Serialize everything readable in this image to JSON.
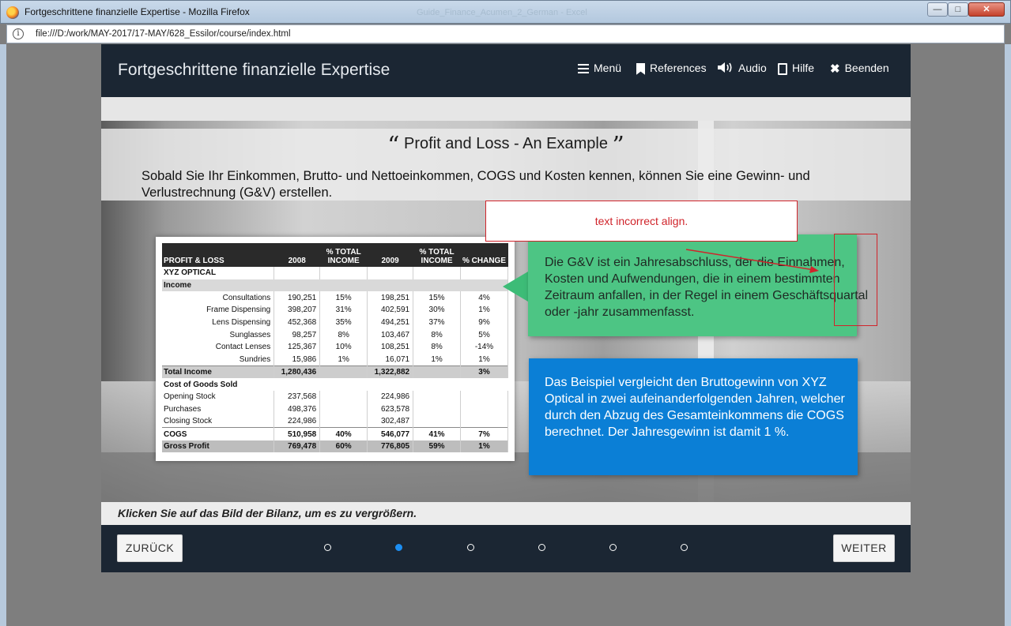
{
  "window": {
    "title": "Fortgeschrittene finanzielle Expertise - Mozilla Firefox",
    "ghost_title": "Guide_Finance_Acumen_2_German - Excel",
    "url": "file:///D:/work/MAY-2017/17-MAY/628_Essilor/course/index.html",
    "min_label": "—",
    "max_label": "□",
    "close_label": "✕"
  },
  "header": {
    "course_title": "Fortgeschrittene finanzielle Expertise",
    "nav": {
      "menu": "Menü",
      "references": "References",
      "audio": "Audio",
      "help": "Hilfe",
      "exit": "Beenden"
    }
  },
  "slide": {
    "open_quote": "“",
    "title": "Profit and Loss - An Example",
    "close_quote": "”",
    "intro": "Sobald Sie Ihr Einkommen, Brutto- und Nettoeinkommen, COGS und Kosten kennen, können Sie eine Gewinn- und Verlustrechnung (G&V) erstellen.",
    "green_text": "Die G&V ist ein Jahresabschluss, der die Einnahmen, Kosten und Aufwendungen, die in einem bestimmten Zeitraum anfallen, in der Regel in einem Geschäftsquartal oder -jahr zusammenfasst.",
    "blue_text": "Das Beispiel vergleicht den Bruttogewinn von XYZ Optical in zwei aufeinanderfolgenden Jahren, welcher durch den Abzug des Gesamteinkommens die COGS berechnet. Der Jahresgewinn ist damit 1 %.",
    "annotation": "text incorrect align.",
    "caption": "Klicken Sie auf das Bild der Bilanz, um es zu vergrößern."
  },
  "table": {
    "headers": [
      "PROFIT & LOSS",
      "2008",
      "% TOTAL INCOME",
      "2009",
      "% TOTAL INCOME",
      "% CHANGE"
    ],
    "company": "XYZ OPTICAL",
    "income_label": "Income",
    "income_rows": [
      [
        "Consultations",
        "190,251",
        "15%",
        "198,251",
        "15%",
        "4%"
      ],
      [
        "Frame Dispensing",
        "398,207",
        "31%",
        "402,591",
        "30%",
        "1%"
      ],
      [
        "Lens Dispensing",
        "452,368",
        "35%",
        "494,251",
        "37%",
        "9%"
      ],
      [
        "Sunglasses",
        "98,257",
        "8%",
        "103,467",
        "8%",
        "5%"
      ],
      [
        "Contact Lenses",
        "125,367",
        "10%",
        "108,251",
        "8%",
        "-14%"
      ],
      [
        "Sundries",
        "15,986",
        "1%",
        "16,071",
        "1%",
        "1%"
      ]
    ],
    "total_income": [
      "Total Income",
      "1,280,436",
      "",
      "1,322,882",
      "",
      "3%"
    ],
    "cogs_label": "Cost of Goods Sold",
    "cogs_rows": [
      [
        "Opening Stock",
        "237,568",
        "",
        "224,986",
        "",
        ""
      ],
      [
        "Purchases",
        "498,376",
        "",
        "623,578",
        "",
        ""
      ],
      [
        "Closing Stock",
        "224,986",
        "",
        "302,487",
        "",
        ""
      ]
    ],
    "cogs_total": [
      "COGS",
      "510,958",
      "40%",
      "546,077",
      "41%",
      "7%"
    ],
    "gross_profit": [
      "Gross Profit",
      "769,478",
      "60%",
      "776,805",
      "59%",
      "1%"
    ]
  },
  "footer": {
    "back": "ZURÜCK",
    "next": "WEITER",
    "page_count": 6,
    "active_page": 2
  }
}
